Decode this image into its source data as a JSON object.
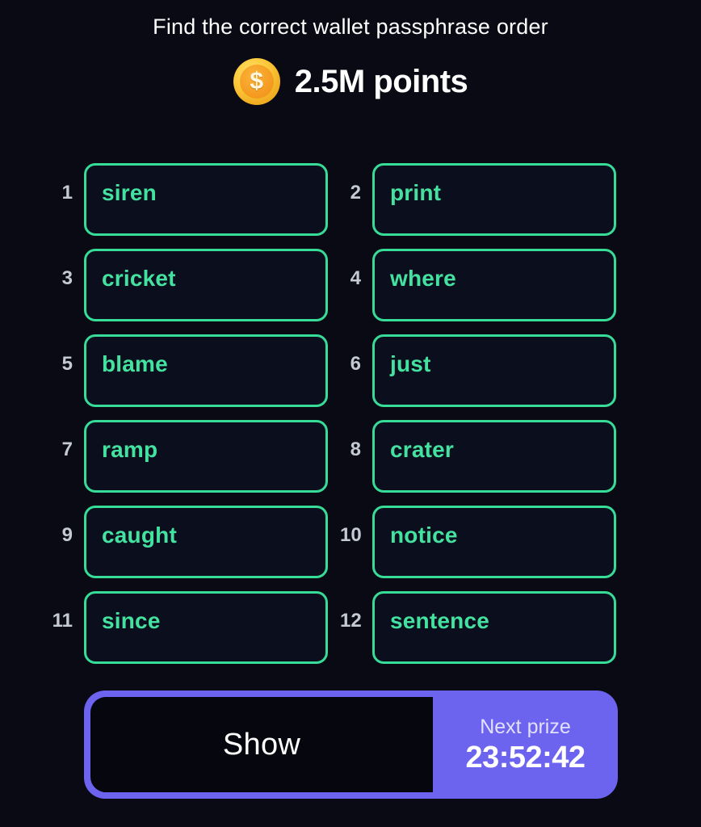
{
  "header": {
    "title": "Find the correct wallet passphrase order",
    "coin_icon": "gold-coin-dollar-icon",
    "coin_glyph": "$",
    "points_label": "2.5M points"
  },
  "grid": {
    "words": [
      {
        "index": "1",
        "word": "siren"
      },
      {
        "index": "2",
        "word": "print"
      },
      {
        "index": "3",
        "word": "cricket"
      },
      {
        "index": "4",
        "word": "where"
      },
      {
        "index": "5",
        "word": "blame"
      },
      {
        "index": "6",
        "word": "just"
      },
      {
        "index": "7",
        "word": "ramp"
      },
      {
        "index": "8",
        "word": "crater"
      },
      {
        "index": "9",
        "word": "caught"
      },
      {
        "index": "10",
        "word": "notice"
      },
      {
        "index": "11",
        "word": "since"
      },
      {
        "index": "12",
        "word": "sentence"
      }
    ]
  },
  "action_bar": {
    "show_label": "Show",
    "prize_label": "Next prize",
    "prize_timer": "23:52:42"
  },
  "colors": {
    "background": "#090a14",
    "word_border": "#36dc97",
    "word_text": "#43e2a0",
    "index_text": "#c4c9d4",
    "accent_purple": "#6c63ef",
    "coin_gold": "#fbc83a",
    "coin_orange": "#f59c22",
    "white": "#ffffff"
  }
}
